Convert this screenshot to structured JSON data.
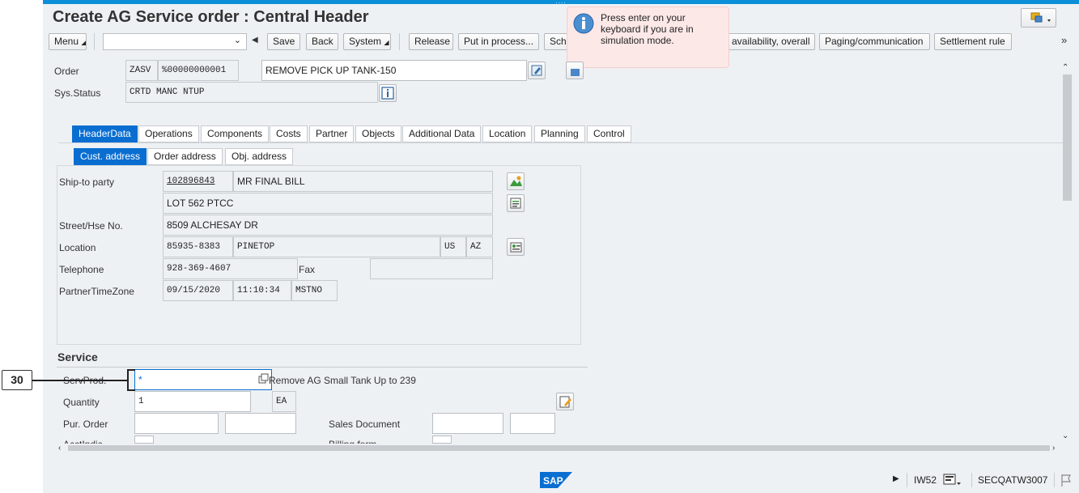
{
  "window": {
    "title": "Create AG Service order : Central Header"
  },
  "toolbar": {
    "menu_label": "Menu",
    "command_value": "",
    "save_label": "Save",
    "back_label": "Back",
    "system_label": "System",
    "buttons": [
      "Release",
      "Put in process...",
      "Sch",
      "availability, overall",
      "Paging/communication",
      "Settlement rule"
    ]
  },
  "hint": {
    "text": "Press enter on your keyboard if you are in simulation mode."
  },
  "header": {
    "order_label": "Order",
    "order_type": "ZASV",
    "order_number": "%00000000001",
    "order_description": "REMOVE PICK UP TANK-150",
    "sysstatus_label": "Sys.Status",
    "sysstatus_value": "CRTD MANC NTUP"
  },
  "tabs": [
    "HeaderData",
    "Operations",
    "Components",
    "Costs",
    "Partner",
    "Objects",
    "Additional Data",
    "Location",
    "Planning",
    "Control"
  ],
  "subtabs": [
    "Cust. address",
    "Order address",
    "Obj. address"
  ],
  "address": {
    "shipto_label": "Ship-to party",
    "shipto_number": "102896843",
    "shipto_name": "MR FINAL BILL",
    "name2": "LOT 562 PTCC",
    "street_label": "Street/Hse No.",
    "street_value": "8509 ALCHESAY DR",
    "location_label": "Location",
    "postal_code": "85935-8383",
    "city": "PINETOP",
    "country": "US",
    "region": "AZ",
    "telephone_label": "Telephone",
    "telephone_value": "928-369-4607",
    "fax_label": "Fax",
    "fax_value": "",
    "timezone_label": "PartnerTimeZone",
    "tz_date": "09/15/2020",
    "tz_time": "11:10:34",
    "tz_zone": "MSTNO"
  },
  "service": {
    "heading": "Service",
    "servprod_label": "ServProd.",
    "servprod_value": "*",
    "servprod_desc": "Remove AG Small Tank Up to 239",
    "quantity_label": "Quantity",
    "quantity_value": "1",
    "quantity_unit": "EA",
    "purorder_label": "Pur. Order",
    "sales_doc_label": "Sales Document",
    "acctindic_label": "AcctIndic",
    "billing_form_label": "Billing form"
  },
  "annotation": {
    "callout_number": "30"
  },
  "statusbar": {
    "transaction": "IW52",
    "system": "SECQATW3007",
    "logo_text": "SAP"
  }
}
